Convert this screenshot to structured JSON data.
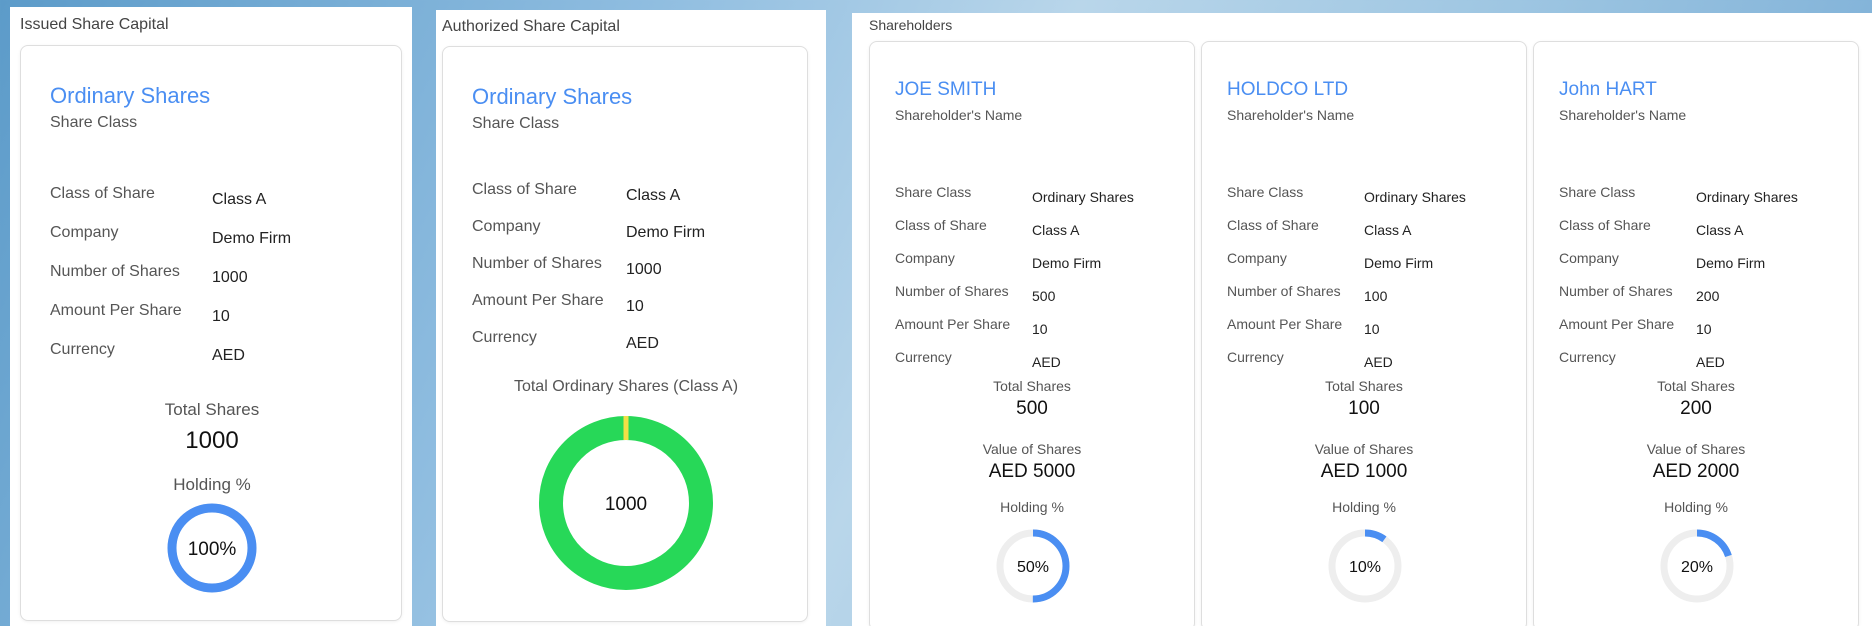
{
  "issued": {
    "panel_title": "Issued Share Capital",
    "share_name": "Ordinary Shares",
    "share_sub": "Share Class",
    "rows": [
      {
        "label": "Class of Share",
        "value": "Class A"
      },
      {
        "label": "Company",
        "value": "Demo Firm"
      },
      {
        "label": "Number of Shares",
        "value": "1000"
      },
      {
        "label": "Amount Per Share",
        "value": "10"
      },
      {
        "label": "Currency",
        "value": "AED"
      }
    ],
    "total_label": "Total Shares",
    "total_value": "1000",
    "holding_label": "Holding %",
    "holding_text": "100%",
    "holding_fraction": 1.0,
    "ring_color": "#4a8ef2"
  },
  "authorized": {
    "panel_title": "Authorized Share Capital",
    "share_name": "Ordinary Shares",
    "share_sub": "Share Class",
    "rows": [
      {
        "label": "Class of Share",
        "value": "Class A"
      },
      {
        "label": "Company",
        "value": "Demo Firm"
      },
      {
        "label": "Number of Shares",
        "value": "1000"
      },
      {
        "label": "Amount Per Share",
        "value": "10"
      },
      {
        "label": "Currency",
        "value": "AED"
      }
    ],
    "chart_label": "Total Ordinary Shares (Class A)",
    "chart_center": "1000",
    "ring_color": "#27d858",
    "marker_color": "#f2e046"
  },
  "shareholders": {
    "panel_title": "Shareholders",
    "name_sub": "Shareholder's Name",
    "cards": [
      {
        "name": "JOE SMITH",
        "rows": [
          {
            "label": "Share Class",
            "value": "Ordinary Shares"
          },
          {
            "label": "Class of Share",
            "value": "Class A"
          },
          {
            "label": "Company",
            "value": "Demo Firm"
          },
          {
            "label": "Number of Shares",
            "value": "500"
          },
          {
            "label": "Amount Per Share",
            "value": "10"
          },
          {
            "label": "Currency",
            "value": "AED"
          }
        ],
        "total_label": "Total Shares",
        "total_value": "500",
        "value_label": "Value of Shares",
        "value_value": "AED 5000",
        "holding_label": "Holding %",
        "holding_text": "50%",
        "holding_fraction": 0.5
      },
      {
        "name": "HOLDCO LTD",
        "rows": [
          {
            "label": "Share Class",
            "value": "Ordinary Shares"
          },
          {
            "label": "Class of Share",
            "value": "Class A"
          },
          {
            "label": "Company",
            "value": "Demo Firm"
          },
          {
            "label": "Number of Shares",
            "value": "100"
          },
          {
            "label": "Amount Per Share",
            "value": "10"
          },
          {
            "label": "Currency",
            "value": "AED"
          }
        ],
        "total_label": "Total Shares",
        "total_value": "100",
        "value_label": "Value of Shares",
        "value_value": "AED 1000",
        "holding_label": "Holding %",
        "holding_text": "10%",
        "holding_fraction": 0.1
      },
      {
        "name": "John HART",
        "rows": [
          {
            "label": "Share Class",
            "value": "Ordinary Shares"
          },
          {
            "label": "Class of Share",
            "value": "Class A"
          },
          {
            "label": "Company",
            "value": "Demo Firm"
          },
          {
            "label": "Number of Shares",
            "value": "200"
          },
          {
            "label": "Amount Per Share",
            "value": "10"
          },
          {
            "label": "Currency",
            "value": "AED"
          }
        ],
        "total_label": "Total Shares",
        "total_value": "200",
        "value_label": "Value of Shares",
        "value_value": "AED 2000",
        "holding_label": "Holding %",
        "holding_text": "20%",
        "holding_fraction": 0.2
      }
    ],
    "ring_color": "#4a8ef2",
    "track_color": "#eeeeee"
  }
}
